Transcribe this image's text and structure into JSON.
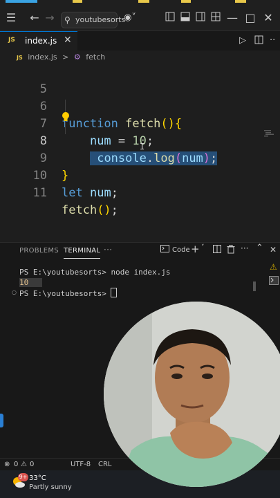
{
  "titlebar": {
    "search_text": "youtubesorts"
  },
  "tab": {
    "lang_badge": "JS",
    "file_name": "index.js"
  },
  "breadcrumb": {
    "file": "index.js",
    "separator": ">",
    "symbol": "fetch"
  },
  "editor": {
    "lines": [
      {
        "number": "5",
        "text": ""
      },
      {
        "number": "6",
        "text": "function fetch(){"
      },
      {
        "number": "7",
        "text": "    num = 10;"
      },
      {
        "number": "8",
        "text": "    console.log(num);"
      },
      {
        "number": "9",
        "text": "}"
      },
      {
        "number": "10",
        "text": "let num;"
      },
      {
        "number": "11",
        "text": "fetch();"
      }
    ],
    "tokens": {
      "function_kw": "function",
      "fn_name": "fetch",
      "paren_open": "(",
      "paren_close": ")",
      "brace_open": "{",
      "brace_close": "}",
      "var_num": "num",
      "assign": " = ",
      "num_value": "10",
      "semicolon": ";",
      "console": "console",
      "dot": ".",
      "log": "log",
      "let_kw": "let",
      "fetch_call": "fetch",
      "call_parens": "()"
    },
    "active_line": "8"
  },
  "panel": {
    "tab_problems": "PROBLEMS",
    "tab_terminal": "TERMINAL",
    "more": "···",
    "shell_label": "Code",
    "terminal_lines": [
      "PS E:\\youtubesorts> node index.js",
      "10",
      "PS E:\\youtubesorts> "
    ]
  },
  "statusbar": {
    "errors": "0",
    "warnings": "0",
    "encoding": "UTF-8",
    "eol": "CRL"
  },
  "taskbar": {
    "weather_badge": "9+",
    "temperature": "33°C",
    "condition": "Partly sunny"
  },
  "colors": {
    "accent": "#0078d4",
    "selection": "#264f78",
    "keyword": "#569cd6",
    "function": "#dcdcaa",
    "variable": "#9cdcfe",
    "number": "#b5cea8"
  }
}
